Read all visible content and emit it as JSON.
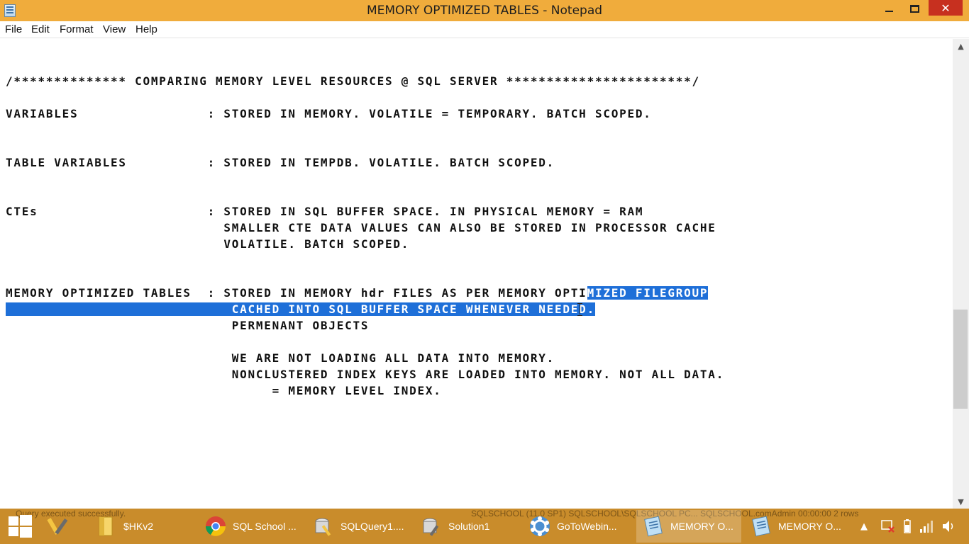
{
  "window": {
    "title": "MEMORY OPTIMIZED TABLES - Notepad",
    "close_glyph": "✕"
  },
  "menu": {
    "items": [
      "File",
      "Edit",
      "Format",
      "View",
      "Help"
    ]
  },
  "editor": {
    "lines": [
      {
        "text": "/************** COMPARING MEMORY LEVEL RESOURCES @ SQL SERVER ***********************/"
      },
      {
        "text": "VARIABLES                : STORED IN MEMORY. VOLATILE = TEMPORARY. BATCH SCOPED."
      },
      {
        "text": "TABLE VARIABLES          : STORED IN TEMPDB. VOLATILE. BATCH SCOPED."
      },
      {
        "text": "CTEs                     : STORED IN SQL BUFFER SPACE. IN PHYSICAL MEMORY = RAM"
      },
      {
        "text": "                           SMALLER CTE DATA VALUES CAN ALSO BE STORED IN PROCESSOR CACHE"
      },
      {
        "text": "                           VOLATILE. BATCH SCOPED."
      },
      {
        "text": "MEMORY OPTIMIZED TABLES  : STORED IN MEMORY hdr FILES AS PER MEMORY OPTI",
        "selected": "MIZED FILEGROUP"
      },
      {
        "text": "",
        "selected": "                            CACHED INTO SQL BUFFER SPACE WHENEVER NEEDED."
      },
      {
        "text": "                            PERMENANT OBJECTS"
      },
      {
        "text": "                            WE ARE NOT LOADING ALL DATA INTO MEMORY."
      },
      {
        "text": "                            NONCLUSTERED INDEX KEYS ARE LOADED INTO MEMORY. NOT ALL DATA."
      },
      {
        "text": "                                 = MEMORY LEVEL INDEX."
      }
    ]
  },
  "scrollbar": {
    "up_glyph": "▲",
    "down_glyph": "▼"
  },
  "taskbar": {
    "background_text": {
      "status": "Query executed successfully.",
      "server": "SQLSCHOOL (11.0 SP1)   SQLSCHOOL\\SQLSCHOOL PC...   SQLSCHOOL.comAdmin   00:00:00   2 rows"
    },
    "items": [
      {
        "label": "",
        "icon": "tools-icon"
      },
      {
        "label": "$HKv2",
        "icon": "folder-icon"
      },
      {
        "label": "SQL School ...",
        "icon": "chrome-icon"
      },
      {
        "label": "SQLQuery1....",
        "icon": "ssms-icon"
      },
      {
        "label": "Solution1",
        "icon": "ssms-icon"
      },
      {
        "label": "GoToWebin...",
        "icon": "gotowebinar-icon"
      },
      {
        "label": "MEMORY O...",
        "icon": "notepad-icon",
        "active": true
      },
      {
        "label": "MEMORY O...",
        "icon": "notepad-icon"
      }
    ],
    "tray_icons": [
      "show-hidden-icons",
      "action-center-icon",
      "battery-icon",
      "network-icon",
      "volume-icon"
    ]
  },
  "colors": {
    "titlebar": "#f0ac3c",
    "taskbar": "#c98c2b",
    "selection": "#1e6fd8",
    "close_button": "#c7301f"
  }
}
